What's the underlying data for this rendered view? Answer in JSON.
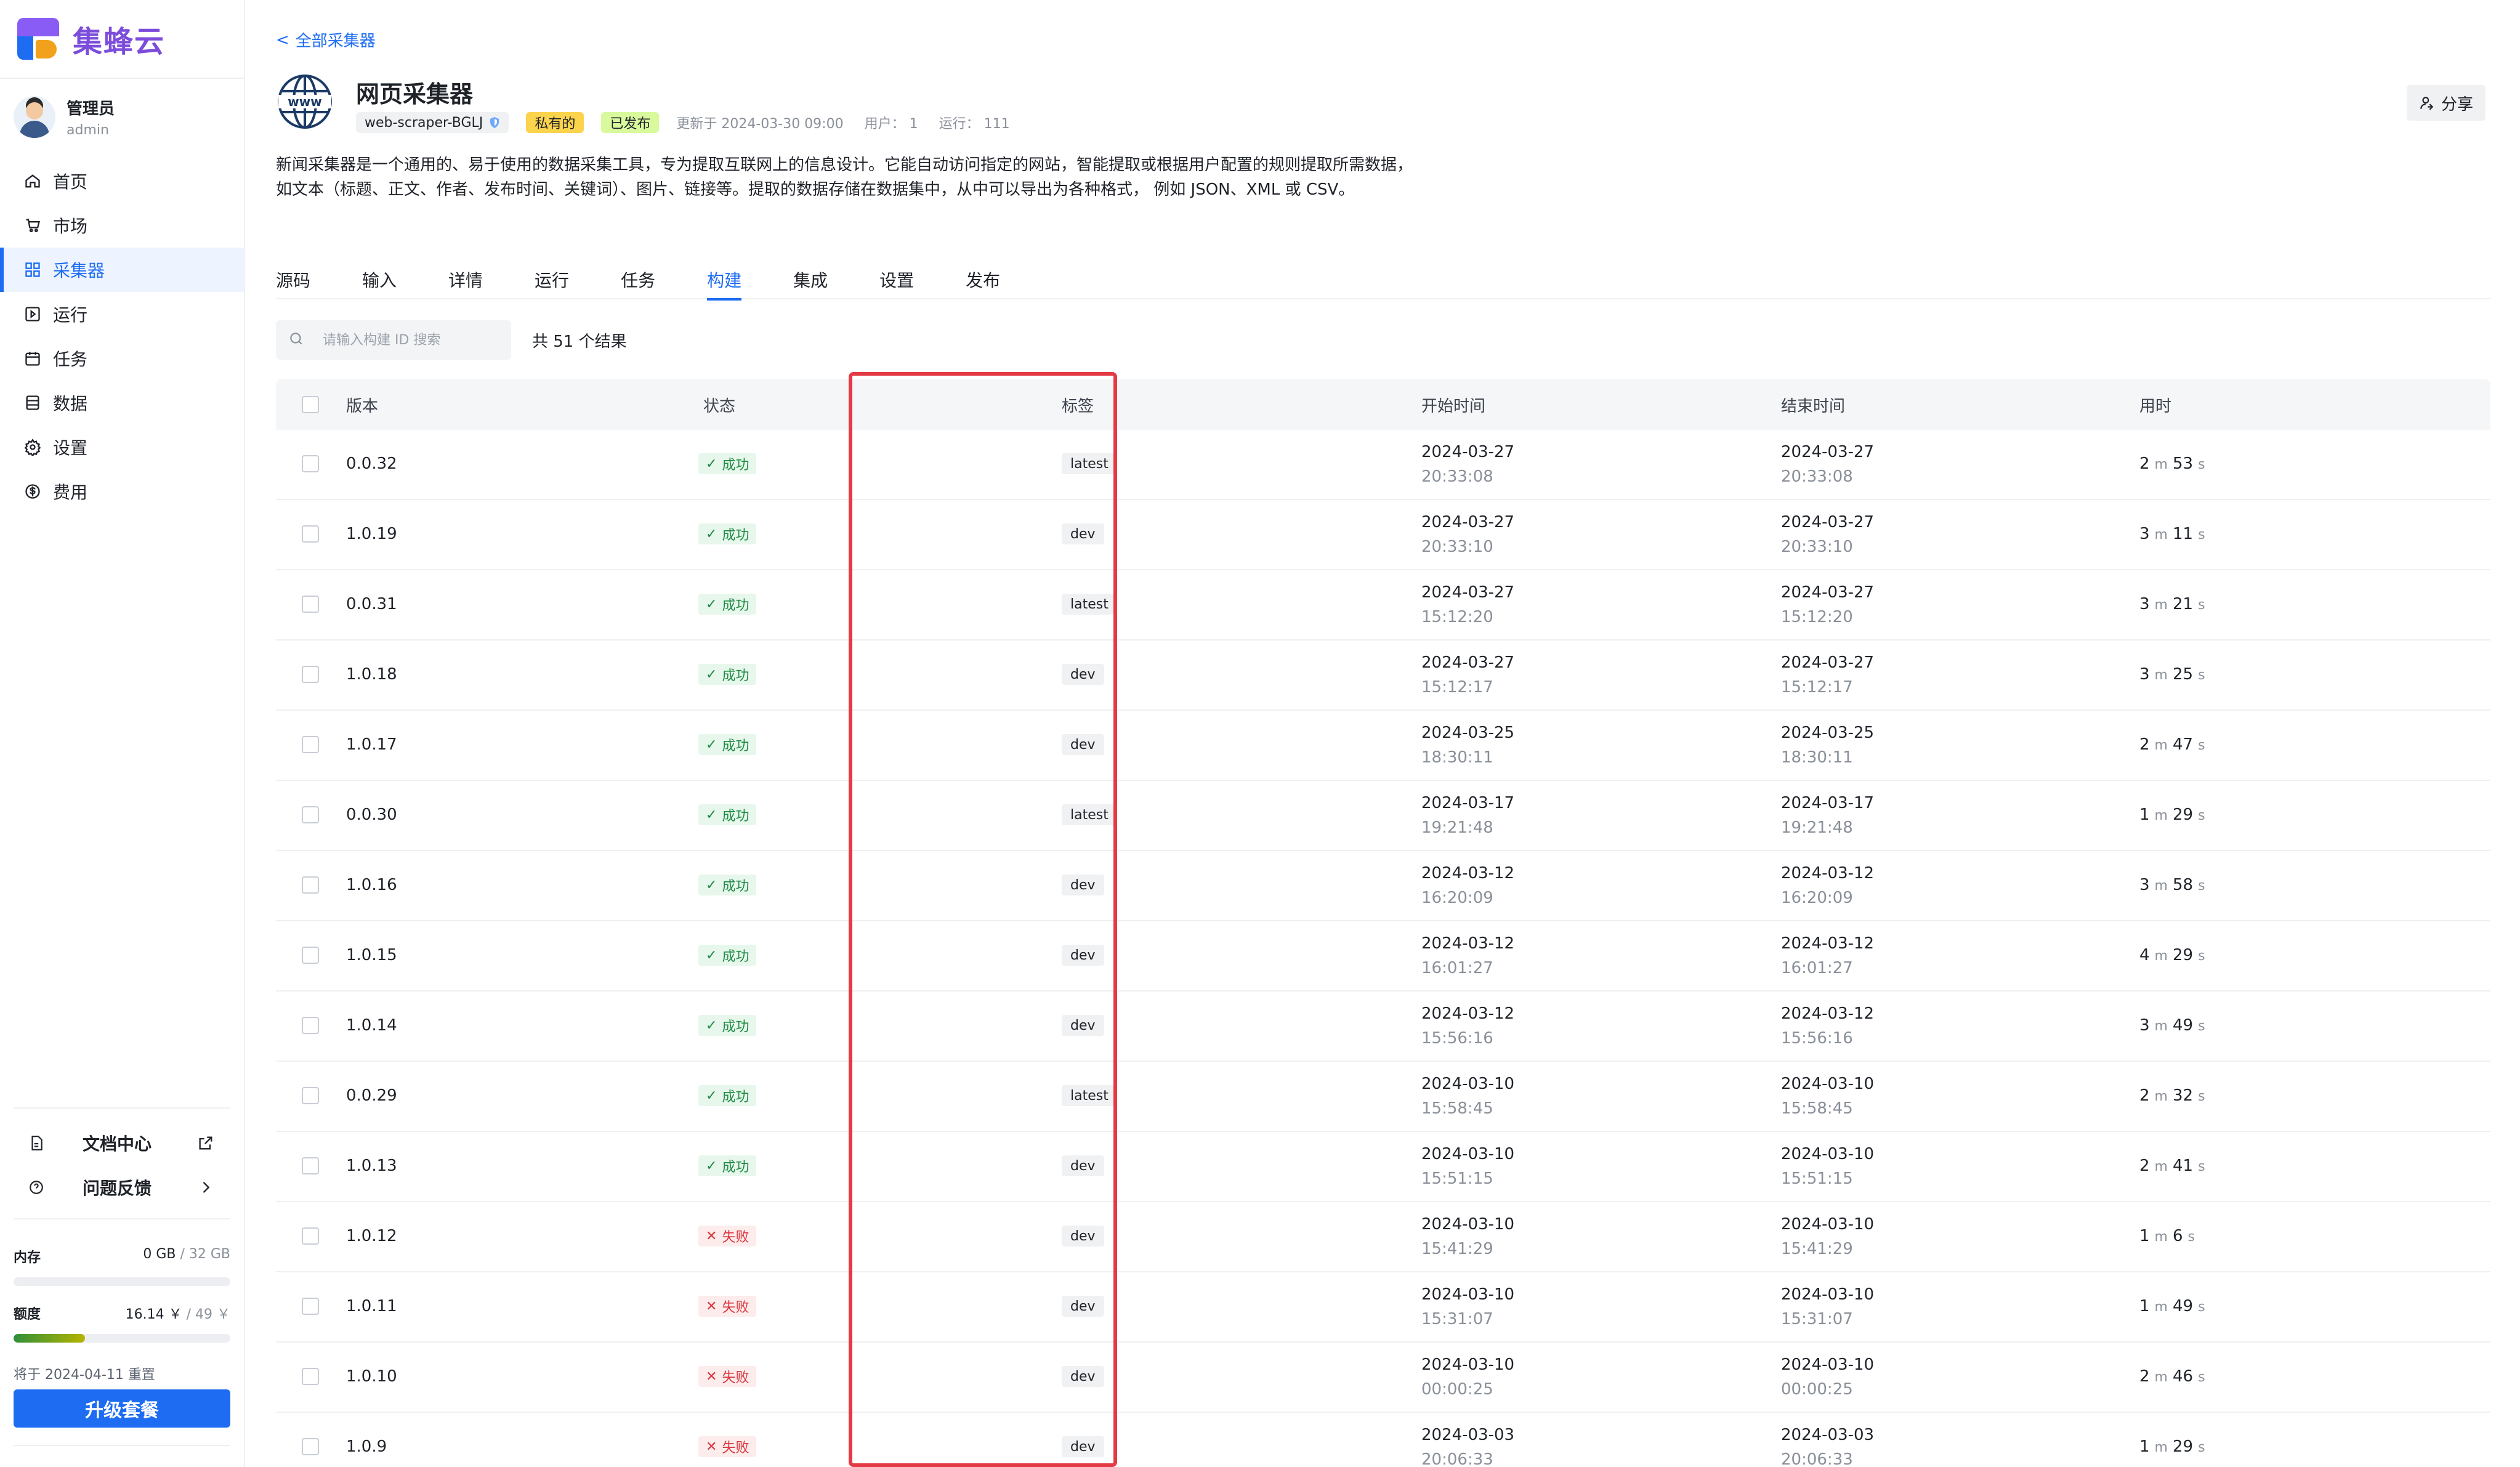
{
  "app": {
    "name": "集蜂云"
  },
  "user": {
    "name": "管理员",
    "role": "admin"
  },
  "nav": [
    {
      "label": "首页",
      "icon": "home-icon"
    },
    {
      "label": "市场",
      "icon": "cart-icon"
    },
    {
      "label": "采集器",
      "icon": "grid-icon",
      "active": true
    },
    {
      "label": "运行",
      "icon": "play-square-icon"
    },
    {
      "label": "任务",
      "icon": "calendar-icon"
    },
    {
      "label": "数据",
      "icon": "database-icon"
    },
    {
      "label": "设置",
      "icon": "gear-icon"
    },
    {
      "label": "费用",
      "icon": "dollar-icon"
    }
  ],
  "side_links": {
    "docs": "文档中心",
    "feedback": "问题反馈"
  },
  "usage": {
    "memory_label": "内存",
    "memory_used": "0 GB",
    "memory_total": " / 32 GB",
    "memory_fraction": 0,
    "quota_label": "额度",
    "quota_used": "16.14 ￥",
    "quota_total": " / 49 ￥",
    "quota_fraction": 0.33,
    "reset_note": "将于 2024-04-11 重置",
    "upgrade_label": "升级套餐"
  },
  "header": {
    "back_label": "全部采集器",
    "title": "网页采集器",
    "scraper_id": "web-scraper-BGLJ",
    "private_label": "私有的",
    "published_label": "已发布",
    "updated": "更新于 2024-03-30 09:00",
    "users": "用户： 1",
    "runs": "运行： 111",
    "share_label": "分享",
    "description": "新闻采集器是一个通用的、易于使用的数据采集工具，专为提取互联网上的信息设计。它能自动访问指定的网站，智能提取或根据用户配置的规则提取所需数据，如文本（标题、正文、作者、发布时间、关键词）、图片、链接等。提取的数据存储在数据集中，从中可以导出为各种格式， 例如 JSON、XML 或 CSV。"
  },
  "tabs": [
    "源码",
    "输入",
    "详情",
    "运行",
    "任务",
    "构建",
    "集成",
    "设置",
    "发布"
  ],
  "active_tab": 5,
  "search": {
    "placeholder": "请输入构建 ID 搜索",
    "result_count": "共 51 个结果"
  },
  "table": {
    "columns": [
      "版本",
      "状态",
      "标签",
      "开始时间",
      "结束时间",
      "用时"
    ],
    "rows": [
      {
        "version": "0.0.32",
        "status": "成功",
        "ok": true,
        "tag": "latest",
        "start_date": "2024-03-27",
        "start_time": "20:33:08",
        "end_date": "2024-03-27",
        "end_time": "20:33:08",
        "min": "2",
        "sec": "53"
      },
      {
        "version": "1.0.19",
        "status": "成功",
        "ok": true,
        "tag": "dev",
        "start_date": "2024-03-27",
        "start_time": "20:33:10",
        "end_date": "2024-03-27",
        "end_time": "20:33:10",
        "min": "3",
        "sec": "11"
      },
      {
        "version": "0.0.31",
        "status": "成功",
        "ok": true,
        "tag": "latest",
        "start_date": "2024-03-27",
        "start_time": "15:12:20",
        "end_date": "2024-03-27",
        "end_time": "15:12:20",
        "min": "3",
        "sec": "21"
      },
      {
        "version": "1.0.18",
        "status": "成功",
        "ok": true,
        "tag": "dev",
        "start_date": "2024-03-27",
        "start_time": "15:12:17",
        "end_date": "2024-03-27",
        "end_time": "15:12:17",
        "min": "3",
        "sec": "25"
      },
      {
        "version": "1.0.17",
        "status": "成功",
        "ok": true,
        "tag": "dev",
        "start_date": "2024-03-25",
        "start_time": "18:30:11",
        "end_date": "2024-03-25",
        "end_time": "18:30:11",
        "min": "2",
        "sec": "47"
      },
      {
        "version": "0.0.30",
        "status": "成功",
        "ok": true,
        "tag": "latest",
        "start_date": "2024-03-17",
        "start_time": "19:21:48",
        "end_date": "2024-03-17",
        "end_time": "19:21:48",
        "min": "1",
        "sec": "29"
      },
      {
        "version": "1.0.16",
        "status": "成功",
        "ok": true,
        "tag": "dev",
        "start_date": "2024-03-12",
        "start_time": "16:20:09",
        "end_date": "2024-03-12",
        "end_time": "16:20:09",
        "min": "3",
        "sec": "58"
      },
      {
        "version": "1.0.15",
        "status": "成功",
        "ok": true,
        "tag": "dev",
        "start_date": "2024-03-12",
        "start_time": "16:01:27",
        "end_date": "2024-03-12",
        "end_time": "16:01:27",
        "min": "4",
        "sec": "29"
      },
      {
        "version": "1.0.14",
        "status": "成功",
        "ok": true,
        "tag": "dev",
        "start_date": "2024-03-12",
        "start_time": "15:56:16",
        "end_date": "2024-03-12",
        "end_time": "15:56:16",
        "min": "3",
        "sec": "49"
      },
      {
        "version": "0.0.29",
        "status": "成功",
        "ok": true,
        "tag": "latest",
        "start_date": "2024-03-10",
        "start_time": "15:58:45",
        "end_date": "2024-03-10",
        "end_time": "15:58:45",
        "min": "2",
        "sec": "32"
      },
      {
        "version": "1.0.13",
        "status": "成功",
        "ok": true,
        "tag": "dev",
        "start_date": "2024-03-10",
        "start_time": "15:51:15",
        "end_date": "2024-03-10",
        "end_time": "15:51:15",
        "min": "2",
        "sec": "41"
      },
      {
        "version": "1.0.12",
        "status": "失败",
        "ok": false,
        "tag": "dev",
        "start_date": "2024-03-10",
        "start_time": "15:41:29",
        "end_date": "2024-03-10",
        "end_time": "15:41:29",
        "min": "1",
        "sec": "6"
      },
      {
        "version": "1.0.11",
        "status": "失败",
        "ok": false,
        "tag": "dev",
        "start_date": "2024-03-10",
        "start_time": "15:31:07",
        "end_date": "2024-03-10",
        "end_time": "15:31:07",
        "min": "1",
        "sec": "49"
      },
      {
        "version": "1.0.10",
        "status": "失败",
        "ok": false,
        "tag": "dev",
        "start_date": "2024-03-10",
        "start_time": "00:00:25",
        "end_date": "2024-03-10",
        "end_time": "00:00:25",
        "min": "2",
        "sec": "46"
      },
      {
        "version": "1.0.9",
        "status": "失败",
        "ok": false,
        "tag": "dev",
        "start_date": "2024-03-03",
        "start_time": "20:06:33",
        "end_date": "2024-03-03",
        "end_time": "20:06:33",
        "min": "1",
        "sec": "29"
      }
    ],
    "min_unit": "m",
    "sec_unit": "s"
  },
  "colors": {
    "accent": "#1d6cf2",
    "success_bg": "#e7f7ec",
    "success_fg": "#1f8a44",
    "fail_bg": "#fdecec",
    "fail_fg": "#d9363e",
    "highlight": "#e33a45",
    "quota_gradient": [
      "#2f8f3a",
      "#b5b500"
    ]
  }
}
